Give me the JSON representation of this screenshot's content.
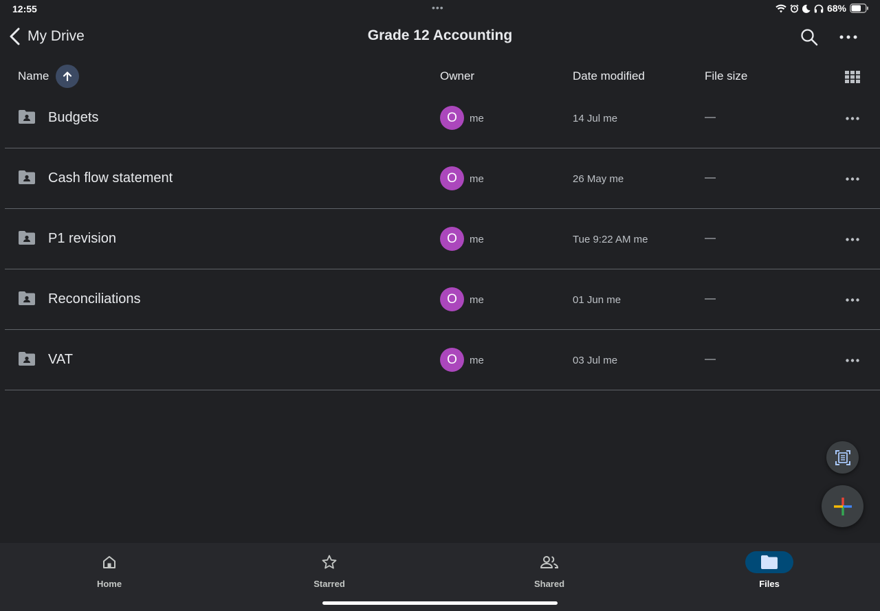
{
  "status": {
    "time": "12:55",
    "battery": "68%"
  },
  "topbar": {
    "back_label": "My Drive",
    "title": "Grade 12 Accounting"
  },
  "columns": {
    "name": "Name",
    "owner": "Owner",
    "date_modified": "Date modified",
    "file_size": "File size"
  },
  "files": [
    {
      "name": "Budgets",
      "owner_initial": "O",
      "owner": "me",
      "modified": "14 Jul me",
      "size": "—"
    },
    {
      "name": "Cash flow statement",
      "owner_initial": "O",
      "owner": "me",
      "modified": "26 May me",
      "size": "—"
    },
    {
      "name": "P1 revision",
      "owner_initial": "O",
      "owner": "me",
      "modified": "Tue 9:22 AM me",
      "size": "—"
    },
    {
      "name": "Reconciliations",
      "owner_initial": "O",
      "owner": "me",
      "modified": "01 Jun me",
      "size": "—"
    },
    {
      "name": "VAT",
      "owner_initial": "O",
      "owner": "me",
      "modified": "03 Jul me",
      "size": "—"
    }
  ],
  "nav": {
    "home": "Home",
    "starred": "Starred",
    "shared": "Shared",
    "files": "Files",
    "active": "files"
  },
  "icons": {
    "back": "chevron-left-icon",
    "search": "search-icon",
    "more": "more-horizontal-icon",
    "sort": "arrow-up-icon",
    "grid": "grid-view-icon",
    "folder": "shared-folder-icon",
    "scan": "scan-document-icon",
    "add": "plus-icon"
  },
  "colors": {
    "background": "#202124",
    "avatar": "#ab47bc",
    "active_nav": "#004a77",
    "sort_button": "#3c4a63"
  }
}
